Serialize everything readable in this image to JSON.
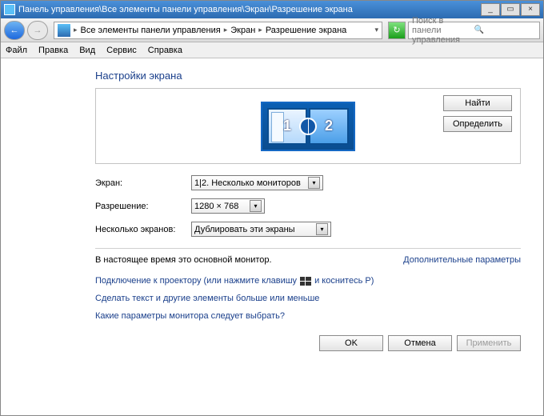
{
  "titlebar": {
    "path": "Панель управления\\Все элементы панели управления\\Экран\\Разрешение экрана"
  },
  "nav": {
    "back_icon": "←",
    "fwd_icon": "→",
    "refresh_icon": "↻",
    "search_placeholder": "Поиск в панели управления",
    "search_icon": "🔍",
    "crumbs": [
      "Все элементы панели управления",
      "Экран",
      "Разрешение экрана"
    ],
    "dropdown_arrow": "▾"
  },
  "menu": {
    "file": "Файл",
    "edit": "Правка",
    "view": "Вид",
    "tools": "Сервис",
    "help": "Справка"
  },
  "page": {
    "heading": "Настройки экрана",
    "find_btn": "Найти",
    "identify_btn": "Определить",
    "monitor1_num": "1",
    "monitor2_num": "2",
    "label_display": "Экран:",
    "value_display": "1|2. Несколько мониторов",
    "label_resolution": "Разрешение:",
    "value_resolution": "1280 × 768",
    "label_multi": "Несколько экранов:",
    "value_multi": "Дублировать эти экраны",
    "status": "В настоящее время это основной монитор.",
    "advanced": "Дополнительные параметры",
    "link_projector_a": "Подключение к проектору (или нажмите клавишу",
    "link_projector_b": "и коснитесь P)",
    "link_textsize": "Сделать текст и другие элементы больше или меньше",
    "link_which": "Какие параметры монитора следует выбрать?",
    "ok": "OK",
    "cancel": "Отмена",
    "apply": "Применить",
    "arrow": "▾"
  }
}
